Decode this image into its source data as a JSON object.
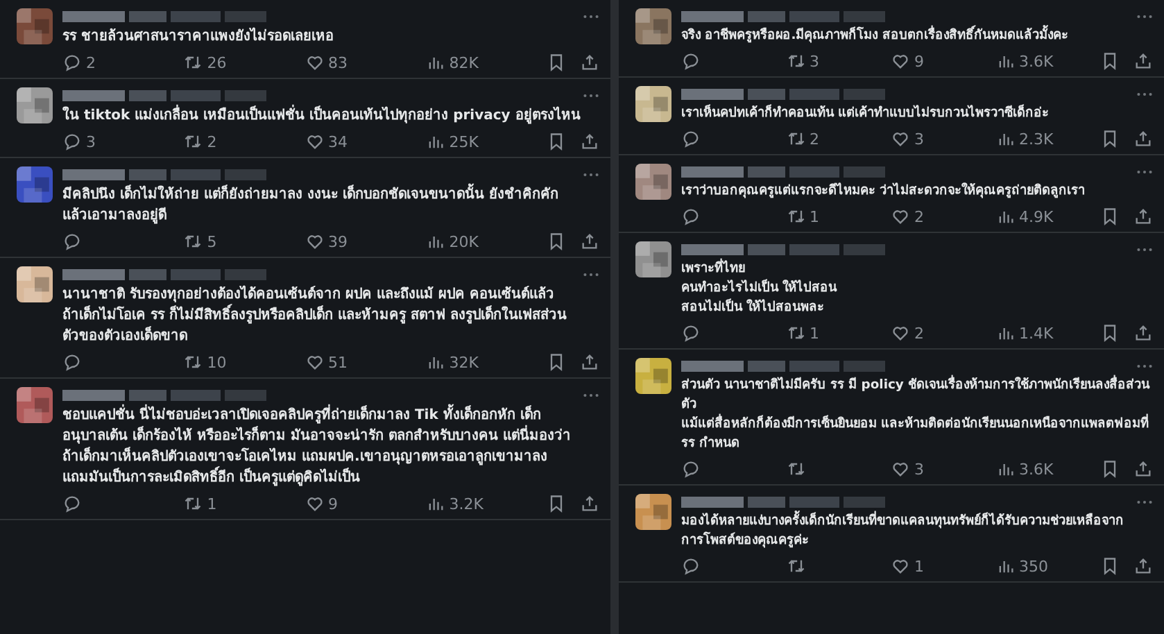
{
  "columns": [
    {
      "posts": [
        {
          "color": "#7a4a3a",
          "text": "รร ชายล้วนศาสนาราคาแพงยังไม่รอดเลยเหอ",
          "replies": "2",
          "reposts": "26",
          "likes": "83",
          "views": "82K"
        },
        {
          "color": "#9a9a9a",
          "text": "ใน tiktok แม่งเกลื่อน เหมือนเป็นแฟชั่น เป็นคอนเท้นไปทุกอย่าง privacy อยู่ตรงไหน",
          "replies": "3",
          "reposts": "2",
          "likes": "34",
          "views": "25K"
        },
        {
          "color": "#3a4fc0",
          "text": "มีคลิปนึง เด็กไม่ให้ถ่าย แต่ก็ยังถ่ายมาลง งงนะ เด็กบอกชัดเจนขนาดนั้น ยังชำคิกคัก\nแล้วเอามาลงอยู่ดี",
          "reposts": "5",
          "likes": "39",
          "views": "20K"
        },
        {
          "color": "#d8b89a",
          "text": "นานาชาติ รับรองทุกอย่างต้องได้คอนเซ้นต์จาก ผปค  และถึงแม้ ผปค คอนเซ้นต์แล้ว\nถ้าเด็กไม่โอเค รร ก็ไม่มีสิทธิ์ลงรูปหรือคลิปเด็ก และห้ามครู สตาฟ ลงรูปเด็กในเฟสส่วน\nตัวของตัวเองเด็ดขาด",
          "reposts": "10",
          "likes": "51",
          "views": "32K"
        },
        {
          "color": "#b05a5a",
          "text": "ชอบแคปชั่น นี่ไม่ชอบอ่ะเวลาเปิดเจอคลิปครูที่ถ่ายเด็กมาลง Tik ทั้งเด็กอกหัก เด็ก\nอนุบาลเต้น เด็กร้องไห้ หรืออะไรก็ตาม มันอาจจะน่ารัก ตลกสำหรับบางคน แต่นี่มองว่า\nถ้าเด็กมาเห็นคลิปตัวเองเขาจะโอเคไหม แถมผปค.เขาอนุญาตหรอเอาลูกเขามาลง\nแถมมันเป็นการละเมิดสิทธิ์อีก เป็นครูแต่ดูคิดไม่เป็น",
          "reposts": "1",
          "likes": "9",
          "views": "3.2K"
        }
      ]
    },
    {
      "posts": [
        {
          "color": "#8a7560",
          "text": "จริง อาชีพครูหรือผอ.มีคุณภาพก็โมง สอบตกเรื่องสิทธิ์กันหมดแล้วมั้งคะ",
          "reposts": "3",
          "likes": "9",
          "views": "3.6K"
        },
        {
          "color": "#c8b890",
          "text": "เราเห็นคปทเค้าก็ทำคอนเท้น แต่เค้าทำแบบไม่รบกวนไพรวาซีเด็กอ่ะ",
          "reposts": "2",
          "likes": "3",
          "views": "2.3K"
        },
        {
          "color": "#a08880",
          "text": "เราว่าบอกคุณครูแต่แรกจะดีไหมคะ ว่าไม่สะดวกจะให้คุณครูถ่ายติดลูกเรา",
          "reposts": "1",
          "likes": "2",
          "views": "4.9K"
        },
        {
          "color": "#909090",
          "text": "เพราะที่ไทย\nคนทำอะไรไม่เป็น ให้ไปสอน\nสอนไม่เป็น ให้ไปสอนพละ",
          "reposts": "1",
          "likes": "2",
          "views": "1.4K"
        },
        {
          "color": "#c8b040",
          "text": "ส่วนตัว นานาชาติไม่มีครับ รร มี policy ชัดเจนเรื่องห้ามการใช้ภาพนักเรียนลงสื่อส่วนตัว\nแม้แต่สื่อหลักก็ต้องมีการเซ็นยินยอม และห้ามติดต่อนักเรียนนอกเหนือจากแพลตฟอมที่\nรร กำหนด",
          "likes": "3",
          "views": "3.6K"
        },
        {
          "color": "#c89050",
          "text": "มองได้หลายแง่บางครั้งเด็กนักเรียนที่ขาดแคลนทุนทรัพย์ก็ได้รับความช่วยเหลือจาก\nการโพสต์ของคุณครูค่ะ",
          "likes": "1",
          "views": "350"
        }
      ]
    }
  ]
}
